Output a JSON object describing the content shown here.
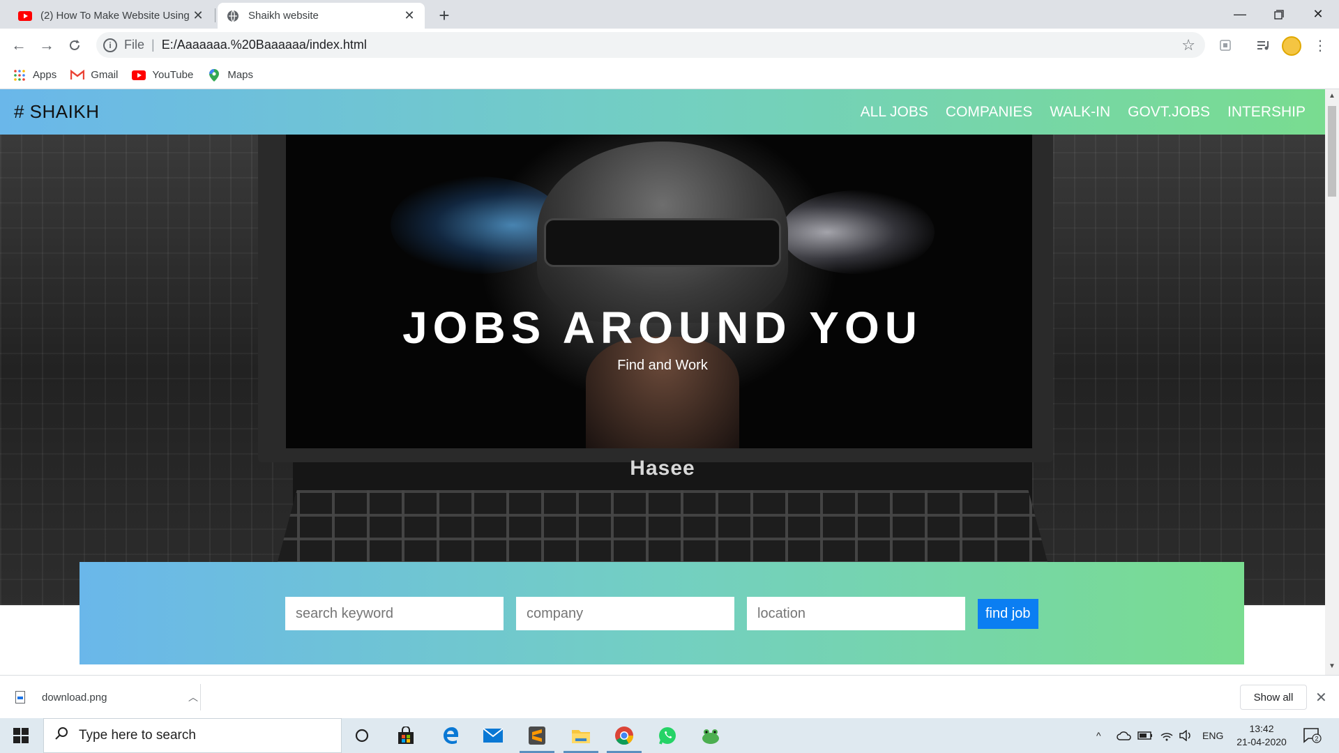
{
  "browser": {
    "tabs": [
      {
        "title": "(2) How To Make Website Using H",
        "favicon": "youtube-icon",
        "active": false
      },
      {
        "title": "Shaikh website",
        "favicon": "globe-icon",
        "active": true
      }
    ],
    "address": {
      "scheme_label": "File",
      "url": "E:/Aaaaaaa.%20Baaaaaa/index.html"
    },
    "bookmarks": [
      {
        "label": "Apps",
        "icon": "apps-grid-icon"
      },
      {
        "label": "Gmail",
        "icon": "gmail-icon"
      },
      {
        "label": "YouTube",
        "icon": "youtube-icon"
      },
      {
        "label": "Maps",
        "icon": "maps-icon"
      }
    ]
  },
  "site": {
    "brand": "# SHAIKH",
    "menu": [
      "ALL JOBS",
      "COMPANIES",
      "WALK-IN",
      "GOVT.JOBS",
      "INTERSHIP"
    ],
    "hero": {
      "title": "JOBS AROUND YOU",
      "subtitle": "Find and Work",
      "laptop_brand": "Hasee"
    },
    "search": {
      "keyword_placeholder": "search keyword",
      "company_placeholder": "company",
      "location_placeholder": "location",
      "button": "find job"
    },
    "colors": {
      "gradient_start": "#6ab7ea",
      "gradient_end": "#79dc90",
      "button": "#0b7ef2"
    }
  },
  "downloads": {
    "file": "download.png",
    "show_all": "Show all"
  },
  "taskbar": {
    "search_placeholder": "Type here to search",
    "apps": [
      "task-view-icon",
      "store-icon",
      "edge-icon",
      "mail-icon",
      "sublime-icon",
      "file-explorer-icon",
      "chrome-icon",
      "whatsapp-icon",
      "frog-app-icon"
    ],
    "language": "ENG",
    "time": "13:42",
    "date": "21-04-2020",
    "notifications": "2"
  }
}
